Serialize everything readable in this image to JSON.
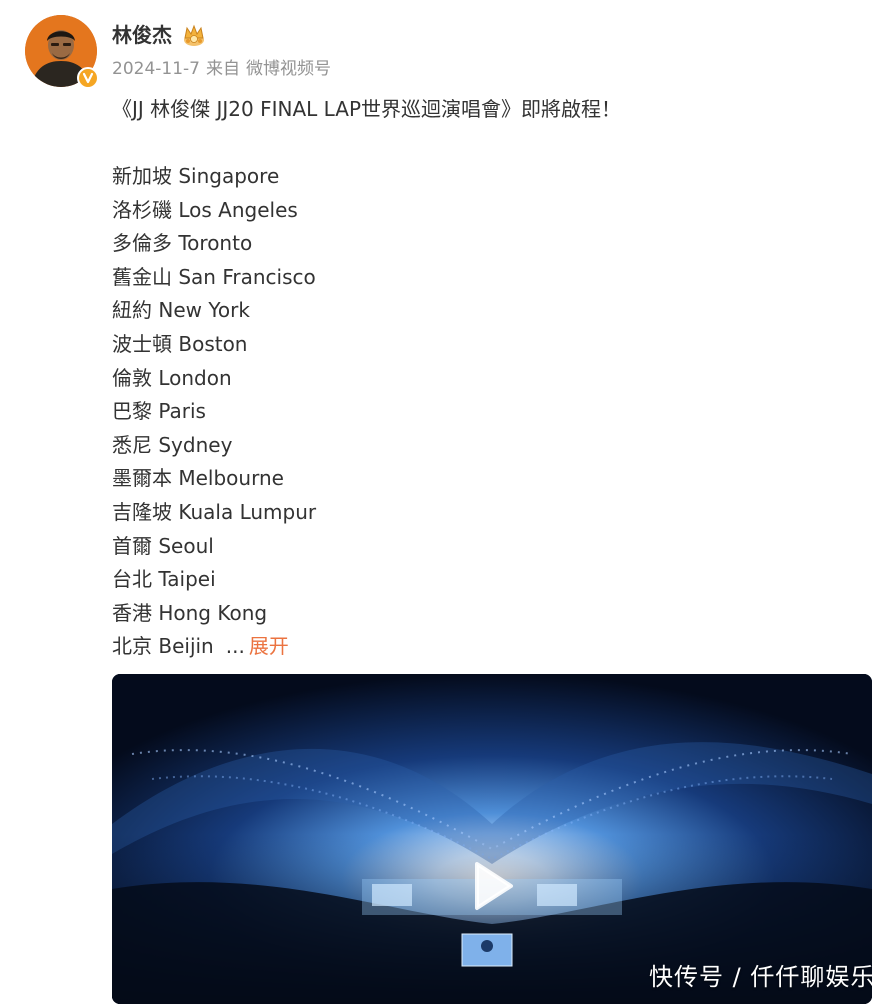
{
  "post": {
    "author": {
      "name": "林俊杰",
      "verified_badge_color": "#f5a623",
      "icons": [
        "avatar",
        "verified-badge-icon",
        "crown-badge-icon"
      ]
    },
    "meta": {
      "date": "2024-11-7",
      "from_label": "来自",
      "source": "微博视频号"
    },
    "text": {
      "headline": "《JJ 林俊傑 JJ20 FINAL LAP世界巡迴演唱會》即將啟程！",
      "cities": [
        "新加坡 Singapore",
        "洛杉磯 Los Angeles",
        "多倫多 Toronto",
        "舊金山 San Francisco",
        "紐約 New York",
        "波士頓 Boston",
        "倫敦 London",
        "巴黎 Paris",
        "悉尼 Sydney",
        "墨爾本 Melbourne",
        "吉隆坡 Kuala Lumpur",
        "首爾 Seoul",
        "台北 Taipei",
        "香港 Hong Kong",
        "北京 Beijin"
      ],
      "ellipsis": "...",
      "expand_label": "展开",
      "expand_color": "#eb7340"
    },
    "video": {
      "play_icon": "play-icon",
      "watermark": "快传号 / 仟仟聊娱乐"
    }
  }
}
